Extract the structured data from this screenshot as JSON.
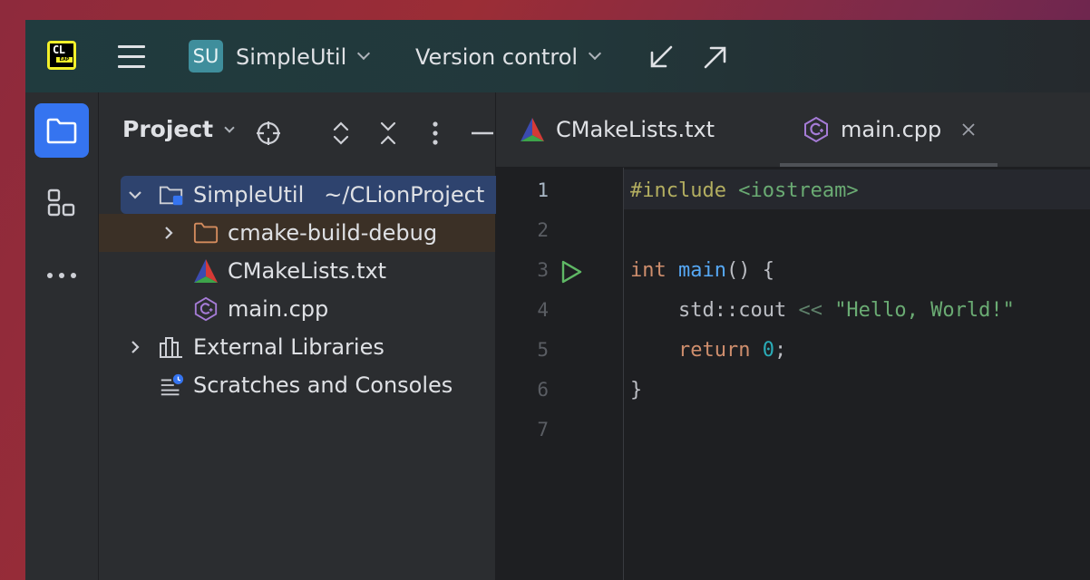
{
  "titlebar": {
    "logo_text": "CL",
    "logo_badge": "EAP",
    "project_badge": "SU",
    "project_name": "SimpleUtil",
    "vcs_label": "Version control"
  },
  "toolstrip": {
    "items": [
      "project-folder-icon",
      "structure-icon",
      "more-icon"
    ],
    "active_color": "#3574f0"
  },
  "project_panel": {
    "title": "Project",
    "tree": [
      {
        "label": "SimpleUtil",
        "sub": "~/CLionProject",
        "expanded": true,
        "selected": true
      },
      {
        "label": "cmake-build-debug",
        "expanded": false
      },
      {
        "label": "CMakeLists.txt"
      },
      {
        "label": "main.cpp"
      },
      {
        "label": "External Libraries",
        "expanded": false
      },
      {
        "label": "Scratches and Consoles"
      }
    ]
  },
  "editor": {
    "tabs": [
      {
        "label": "CMakeLists.txt",
        "active": false
      },
      {
        "label": "main.cpp",
        "active": true
      }
    ],
    "line_numbers": [
      "1",
      "2",
      "3",
      "4",
      "5",
      "6",
      "7"
    ],
    "code": {
      "l1_directive": "#include",
      "l1_header": " <iostream>",
      "l3_int": "int",
      "l3_main": " main",
      "l3_rest": "() {",
      "l4_indent": "    ",
      "l4_std": "std::cout",
      "l4_op": " << ",
      "l4_str": "\"Hello, World!\"",
      "l5_indent": "    ",
      "l5_return": "return",
      "l5_zero": " 0",
      "l5_semi": ";",
      "l6_brace": "}"
    }
  }
}
